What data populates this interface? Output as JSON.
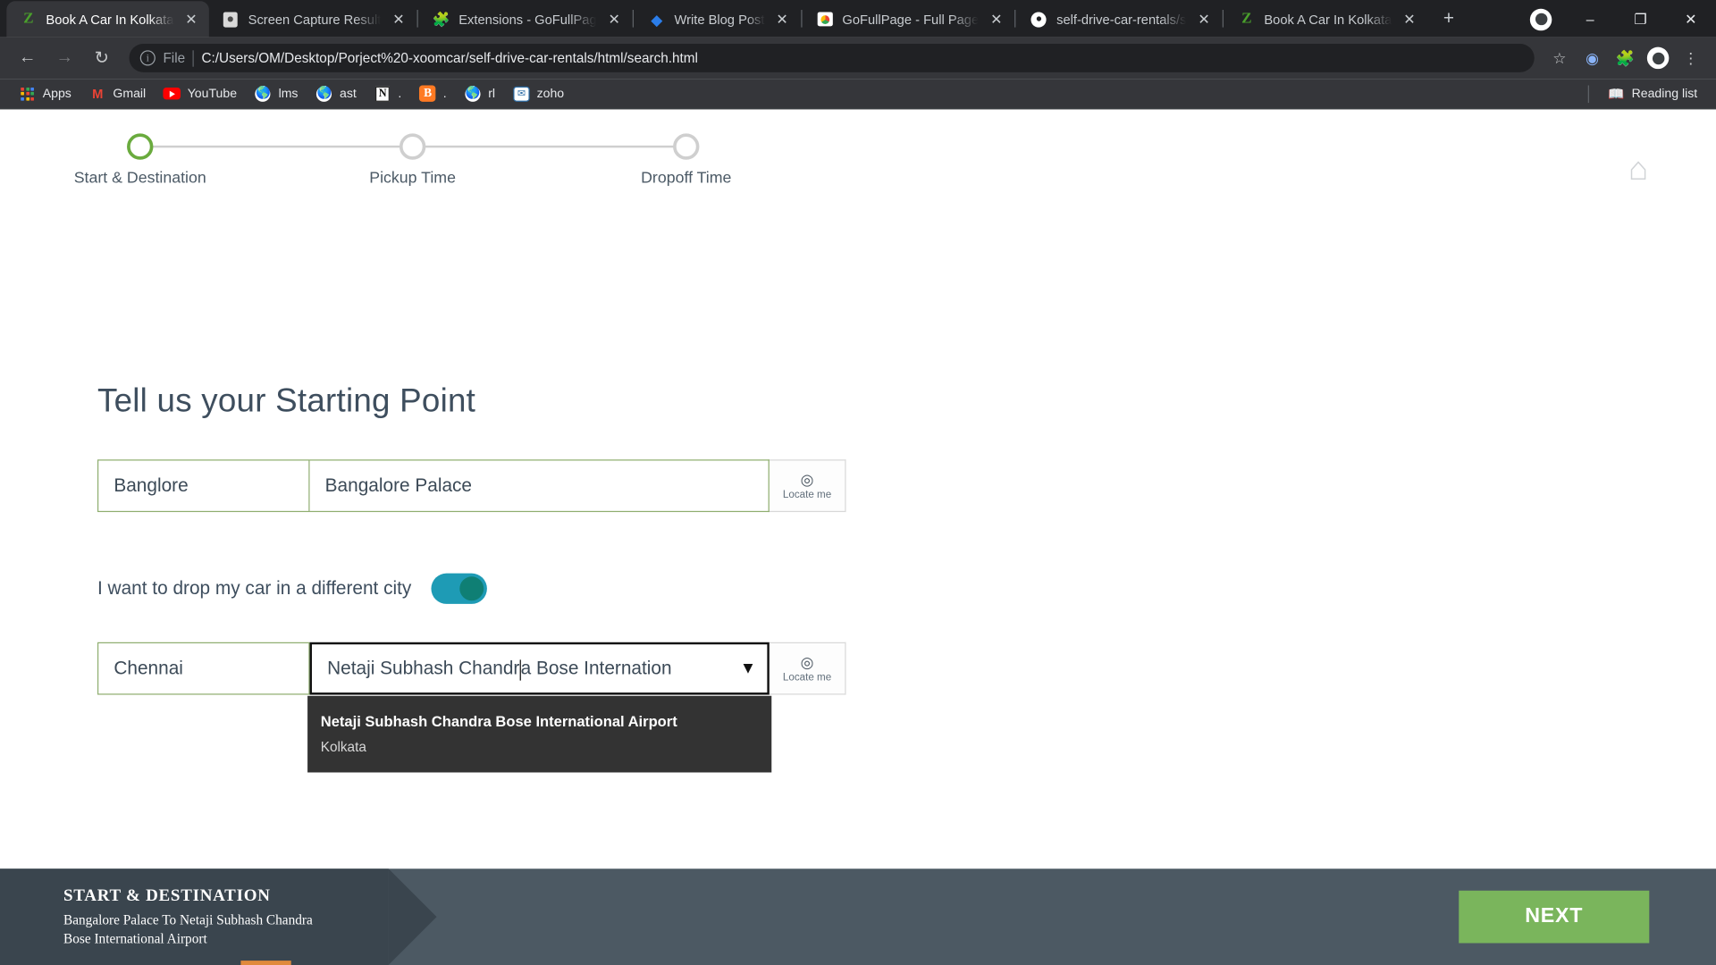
{
  "browser": {
    "tabs": [
      {
        "title": "Book A Car In Kolkata",
        "favicon": "zoomcar-z-icon",
        "active": true,
        "close_label": "✕"
      },
      {
        "title": "Screen Capture Result",
        "favicon": "camera-icon",
        "active": false,
        "close_label": "✕"
      },
      {
        "title": "Extensions - GoFullPag",
        "favicon": "puzzle-icon",
        "active": false,
        "close_label": "✕"
      },
      {
        "title": "Write Blog Post",
        "favicon": "diamond-icon",
        "active": false,
        "close_label": "✕"
      },
      {
        "title": "GoFullPage - Full Page",
        "favicon": "chrome-store-icon",
        "active": false,
        "close_label": "✕"
      },
      {
        "title": "self-drive-car-rentals/s",
        "favicon": "github-icon",
        "active": false,
        "close_label": "✕"
      },
      {
        "title": "Book A Car In Kolkata",
        "favicon": "zoomcar-z-icon",
        "active": false,
        "close_label": "✕"
      }
    ],
    "new_tab_label": "+",
    "window_controls": {
      "minimize": "–",
      "maximize": "❐",
      "close": "✕"
    },
    "toolbar": {
      "back": "←",
      "forward": "→",
      "reload": "↻",
      "scheme_label": "File",
      "url": "C:/Users/OM/Desktop/Porject%20-xoomcar/self-drive-car-rentals/html/search.html",
      "star": "☆",
      "extensions": "❖",
      "puzzle": "⚙",
      "menu": "⋮"
    },
    "bookmarks": [
      {
        "label": "Apps",
        "icon": "apps-grid-icon"
      },
      {
        "label": "Gmail",
        "icon": "gmail-icon"
      },
      {
        "label": "YouTube",
        "icon": "youtube-icon"
      },
      {
        "label": "lms",
        "icon": "globe-icon"
      },
      {
        "label": "ast",
        "icon": "globe-icon"
      },
      {
        "label": ".",
        "icon": "notion-icon"
      },
      {
        "label": ".",
        "icon": "blogger-icon"
      },
      {
        "label": "rl",
        "icon": "globe-icon"
      },
      {
        "label": "zoho",
        "icon": "zoho-icon"
      }
    ],
    "reading_list": {
      "label": "Reading list",
      "icon": "book-icon"
    }
  },
  "page": {
    "stepper": {
      "steps": [
        {
          "label": "Start & Destination",
          "state": "active"
        },
        {
          "label": "Pickup Time",
          "state": "inactive"
        },
        {
          "label": "Dropoff Time",
          "state": "inactive"
        }
      ],
      "active_color": "#6aab3e",
      "inactive_color": "#cfcfcf"
    },
    "home_icon": "⌂",
    "heading": "Tell us your Starting Point",
    "pickup": {
      "city": "Banglore",
      "place": "Bangalore Palace",
      "locate_label": "Locate me",
      "locate_icon": "crosshair-icon"
    },
    "different_city_toggle": {
      "label": "I want to drop my car in a different city",
      "enabled": true,
      "track_color": "#1e9bb5",
      "knob_color": "#0f7f74"
    },
    "dropoff": {
      "city": "Chennai",
      "place": "Netaji Subhash Chandra Bose International Airport",
      "place_visible": "Netaji Subhash Chandr",
      "place_visible_tail": "a Bose Internation",
      "dropdown_arrow": "▼",
      "locate_label": "Locate me",
      "locate_icon": "crosshair-icon"
    },
    "autocomplete": {
      "visible": true,
      "items": [
        {
          "title": "Netaji Subhash Chandra Bose International Airport",
          "subtitle": "Kolkata"
        }
      ]
    },
    "footer": {
      "tag_title": "START & DESTINATION",
      "tag_subtitle": "Bangalore Palace To Netaji Subhash Chandra Bose International Airport",
      "next_label": "NEXT",
      "next_color": "#7ab55c",
      "bar_color": "#4c5963",
      "tag_color": "#3a454e"
    }
  }
}
